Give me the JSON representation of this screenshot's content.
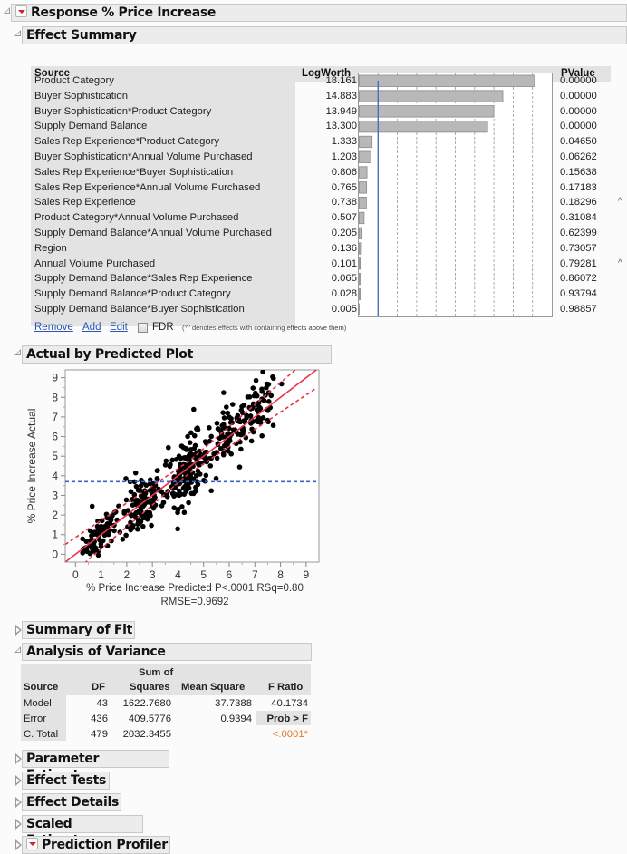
{
  "report": {
    "title": "Response % Price Increase",
    "sections": {
      "effect_summary": "Effect Summary",
      "actual_by_predicted": "Actual by Predicted Plot",
      "summary_of_fit": "Summary of Fit",
      "anova": "Analysis of Variance",
      "parameter_estimates": "Parameter Estimates",
      "effect_tests": "Effect Tests",
      "effect_details": "Effect Details",
      "scaled_estimates": "Scaled Estimates",
      "prediction_profiler": "Prediction Profiler"
    }
  },
  "effect_summary": {
    "headers": {
      "source": "Source",
      "logworth": "LogWorth",
      "pvalue": "PValue"
    },
    "rows": [
      {
        "source": "Product Category",
        "logworth": "18.161",
        "pvalue": "0.00000",
        "caret": ""
      },
      {
        "source": "Buyer Sophistication",
        "logworth": "14.883",
        "pvalue": "0.00000",
        "caret": ""
      },
      {
        "source": "Buyer Sophistication*Product Category",
        "logworth": "13.949",
        "pvalue": "0.00000",
        "caret": ""
      },
      {
        "source": "Supply Demand Balance",
        "logworth": "13.300",
        "pvalue": "0.00000",
        "caret": ""
      },
      {
        "source": "Sales Rep Experience*Product Category",
        "logworth": "1.333",
        "pvalue": "0.04650",
        "caret": ""
      },
      {
        "source": "Buyer Sophistication*Annual Volume Purchased",
        "logworth": "1.203",
        "pvalue": "0.06262",
        "caret": ""
      },
      {
        "source": "Sales Rep Experience*Buyer Sophistication",
        "logworth": "0.806",
        "pvalue": "0.15638",
        "caret": ""
      },
      {
        "source": "Sales Rep Experience*Annual Volume Purchased",
        "logworth": "0.765",
        "pvalue": "0.17183",
        "caret": ""
      },
      {
        "source": "Sales Rep Experience",
        "logworth": "0.738",
        "pvalue": "0.18296",
        "caret": "^"
      },
      {
        "source": "Product Category*Annual Volume Purchased",
        "logworth": "0.507",
        "pvalue": "0.31084",
        "caret": ""
      },
      {
        "source": "Supply Demand Balance*Annual Volume Purchased",
        "logworth": "0.205",
        "pvalue": "0.62399",
        "caret": ""
      },
      {
        "source": "Region",
        "logworth": "0.136",
        "pvalue": "0.73057",
        "caret": ""
      },
      {
        "source": "Annual Volume Purchased",
        "logworth": "0.101",
        "pvalue": "0.79281",
        "caret": "^"
      },
      {
        "source": "Supply Demand Balance*Sales Rep Experience",
        "logworth": "0.065",
        "pvalue": "0.86072",
        "caret": ""
      },
      {
        "source": "Supply Demand Balance*Product Category",
        "logworth": "0.028",
        "pvalue": "0.93794",
        "caret": ""
      },
      {
        "source": "Supply Demand Balance*Buyer Sophistication",
        "logworth": "0.005",
        "pvalue": "0.98857",
        "caret": ""
      }
    ],
    "bar_scale_max": 20,
    "reference_logworth": 2,
    "actions": {
      "remove": "Remove",
      "add": "Add",
      "edit": "Edit",
      "fdr": "FDR"
    },
    "fdr_checked": false,
    "note": "('^' denotes effects with containing effects above them)"
  },
  "chart_data": {
    "type": "scatter",
    "title": "Actual by Predicted Plot",
    "xlabel": "% Price Increase Predicted P<.0001 RSq=0.80",
    "xlabel2": "RMSE=0.9692",
    "ylabel": "% Price Increase Actual",
    "xlim": [
      -0.4,
      9.5
    ],
    "ylim": [
      -0.4,
      9.4
    ],
    "xticks": [
      "0",
      "1",
      "2",
      "3",
      "4",
      "5",
      "6",
      "7",
      "8",
      "9"
    ],
    "yticks": [
      "0",
      "1",
      "2",
      "3",
      "4",
      "5",
      "6",
      "7",
      "8",
      "9"
    ],
    "mean_line_y": 3.7,
    "fit_line": {
      "slope": 1,
      "intercept": 0
    },
    "confidence_band_offset": 0.9,
    "colors": {
      "points": "#000000",
      "fit": "#e8334a",
      "mean": "#3b62c9"
    },
    "seed_description": "480 observations clustered around the y=x line",
    "clusters": [
      {
        "cx": 1.0,
        "cy": 1.0,
        "n": 70,
        "sx": 0.35,
        "sy": 0.45
      },
      {
        "cx": 2.6,
        "cy": 2.6,
        "n": 110,
        "sx": 0.4,
        "sy": 0.8
      },
      {
        "cx": 4.4,
        "cy": 4.3,
        "n": 140,
        "sx": 0.4,
        "sy": 0.85
      },
      {
        "cx": 6.0,
        "cy": 6.1,
        "n": 80,
        "sx": 0.5,
        "sy": 0.8
      },
      {
        "cx": 7.2,
        "cy": 7.3,
        "n": 60,
        "sx": 0.35,
        "sy": 0.9
      },
      {
        "cx": 3.5,
        "cy": 4.2,
        "n": 20,
        "sx": 1.0,
        "sy": 1.2
      }
    ],
    "grid": false
  },
  "anova": {
    "headers": [
      "Source",
      "DF",
      "Sum of Squares",
      "Mean Square",
      "F Ratio"
    ],
    "header_top": "Sum of",
    "header_bottom": "Squares",
    "rows": [
      {
        "source": "Model",
        "df": "43",
        "ss": "1622.7680",
        "ms": "37.7388",
        "f": "40.1734"
      },
      {
        "source": "Error",
        "df": "436",
        "ss": "409.5776",
        "ms": "0.9394",
        "f": "Prob > F"
      },
      {
        "source": "C. Total",
        "df": "479",
        "ss": "2032.3455",
        "ms": "",
        "f": "<.0001*"
      }
    ],
    "prob_color": "#e07a2a"
  }
}
